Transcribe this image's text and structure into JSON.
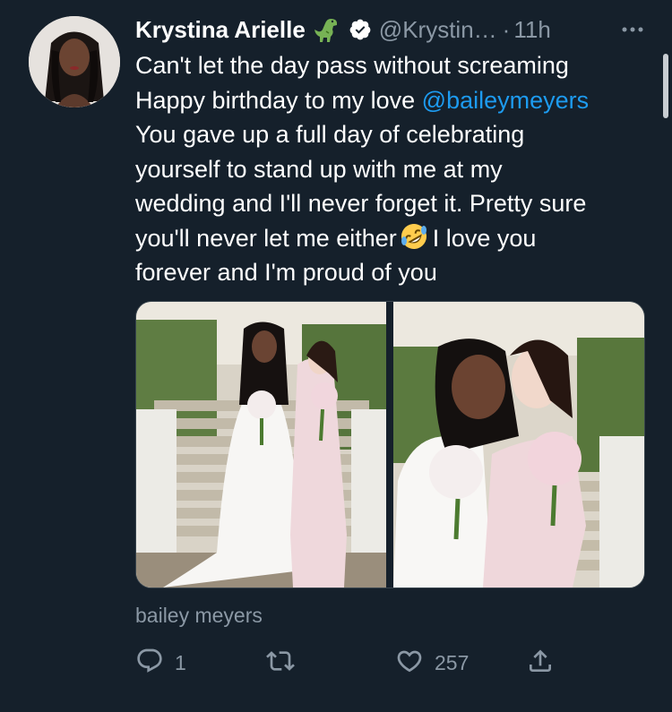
{
  "tweet": {
    "display_name": "Krystina Arielle",
    "handle": "@Krystin…",
    "separator": "·",
    "time": "11h",
    "lines": [
      "Can't let the day pass without screaming",
      "You gave up a full day of celebrating",
      "yourself to stand up with me at my",
      "wedding and I'll never forget it. Pretty sure",
      "you'll never let me either",
      "I love you",
      "forever and I'm proud of you"
    ],
    "line2_prefix": "Happy birthday to my love ",
    "mention": "@baileymeyers",
    "caption": "bailey meyers",
    "replies": "1",
    "retweets": "",
    "likes": "257"
  },
  "icons": {
    "badge_emoji": "t-rex-icon",
    "verified": "verified-badge-icon",
    "inline_emoji": "rolling-on-floor-laughing-emoji",
    "more": "more-icon",
    "reply": "reply-icon",
    "retweet": "retweet-icon",
    "like": "heart-icon",
    "share": "share-icon"
  },
  "colors": {
    "background": "#15202b",
    "text": "#ffffff",
    "muted": "#8b98a5",
    "link": "#1d9bf0"
  }
}
